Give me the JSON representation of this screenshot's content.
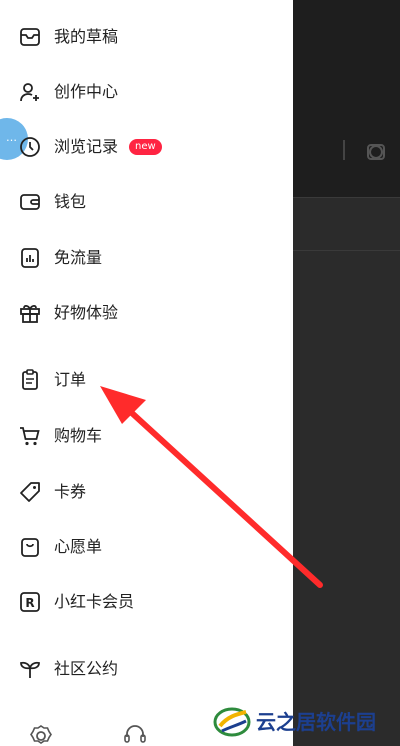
{
  "drawer": {
    "items": [
      {
        "label": "我的草稿",
        "icon": "drafts-icon"
      },
      {
        "label": "创作中心",
        "icon": "creator-center-icon"
      },
      {
        "label": "浏览记录",
        "icon": "history-clock-icon",
        "badge": "new"
      },
      {
        "label": "钱包",
        "icon": "wallet-icon"
      },
      {
        "label": "免流量",
        "icon": "data-free-icon"
      },
      {
        "label": "好物体验",
        "icon": "gift-icon"
      },
      {
        "label": "订单",
        "icon": "order-clipboard-icon"
      },
      {
        "label": "购物车",
        "icon": "shopping-cart-icon"
      },
      {
        "label": "卡券",
        "icon": "coupon-tag-icon"
      },
      {
        "label": "心愿单",
        "icon": "wishlist-icon"
      },
      {
        "label": "小红卡会员",
        "icon": "membership-card-icon"
      },
      {
        "label": "社区公约",
        "icon": "sprout-icon"
      }
    ],
    "bottom_icons": [
      "settings-gear-icon",
      "customer-service-headset-icon"
    ]
  },
  "annotation": {
    "color": "#ff2b2b",
    "points_to": "订单"
  },
  "watermark": {
    "text": "云之居软件园"
  },
  "colors": {
    "accent": "#ff2442",
    "overlay": "#2b2b2b",
    "text": "#222222"
  }
}
